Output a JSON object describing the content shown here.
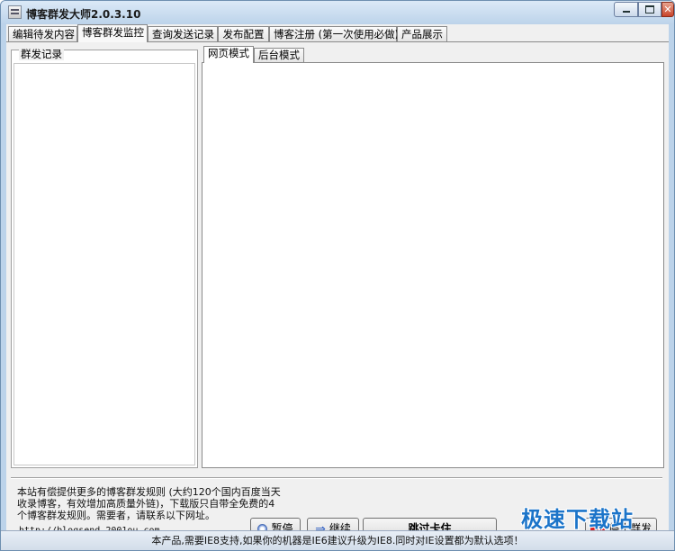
{
  "window": {
    "title": "博客群发大师2.0.3.10",
    "buttons": {
      "minimize": "",
      "maximize": "",
      "close": "✕"
    }
  },
  "tabs": [
    {
      "label": "编辑待发内容",
      "active": false
    },
    {
      "label": "博客群发监控",
      "active": true
    },
    {
      "label": "查询发送记录",
      "active": false
    },
    {
      "label": "发布配置",
      "active": false
    },
    {
      "label": "博客注册 (第一次使用必做)",
      "active": false
    },
    {
      "label": "产品展示",
      "active": false
    }
  ],
  "records": {
    "legend": "群发记录"
  },
  "modes": [
    {
      "label": "网页模式",
      "active": true
    },
    {
      "label": "后台模式",
      "active": false
    }
  ],
  "info": {
    "lines": [
      "本站有偿提供更多的博客群发规则 (大约120个国内百度当天",
      "收录博客，有效增加高质量外链)，下载版只自带全免费的4",
      "个博客群发规则。需要者，请联系以下网址。"
    ],
    "url": "http://blogsend.2001ou.com"
  },
  "buttons": {
    "pause": "暂停",
    "continue": "继续",
    "skip": "跳过卡住",
    "stop": "停止群发"
  },
  "icons": {
    "pause": "pause-icon",
    "continue": "arrow-right-icon",
    "stop": "stop-icon"
  },
  "statusbar": {
    "text": "本产品,需要IE8支持,如果你的机器是IE6建议升级为IE8.同时对IE设置都为默认选项！"
  },
  "watermark": {
    "text": "极速下载站"
  },
  "colors": {
    "accent": "#1b74c9",
    "titlebar": "#bcd3ea",
    "stop": "#d22222"
  }
}
